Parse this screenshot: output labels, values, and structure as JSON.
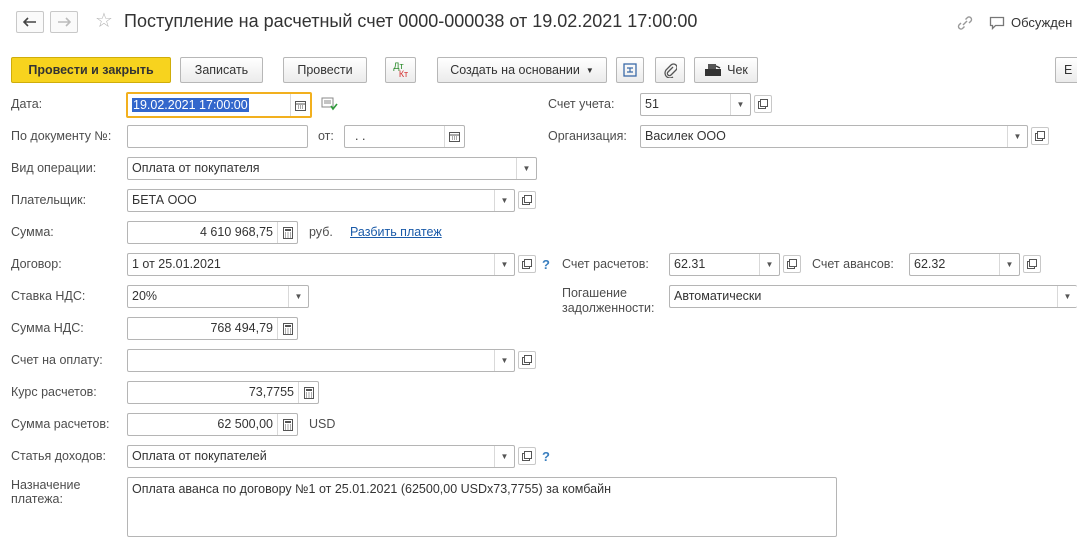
{
  "header": {
    "title": "Поступление на расчетный счет 0000-000038 от 19.02.2021 17:00:00",
    "discussion_label": "Обсужден"
  },
  "toolbar": {
    "post_close": "Провести и закрыть",
    "save": "Записать",
    "post": "Провести",
    "dt_kt_top": "Дт",
    "dt_kt_bottom": "Кт",
    "create_based": "Создать на основании",
    "receipt": "Чек",
    "more_label": "Е"
  },
  "form": {
    "date": {
      "label": "Дата:",
      "value": "19.02.2021 17:00:00"
    },
    "doc_number": {
      "label": "По документу №:",
      "value": ""
    },
    "doc_from": {
      "label": "от:",
      "value": " .  ."
    },
    "operation_type": {
      "label": "Вид операции:",
      "value": "Оплата от покупателя"
    },
    "payer": {
      "label": "Плательщик:",
      "value": "БЕТА ООО"
    },
    "amount": {
      "label": "Сумма:",
      "value": "4 610 968,75",
      "currency": "руб.",
      "split_link": "Разбить платеж"
    },
    "contract": {
      "label": "Договор:",
      "value": "1 от 25.01.2021",
      "help": "?"
    },
    "vat_rate": {
      "label": "Ставка НДС:",
      "value": "20%"
    },
    "vat_amount": {
      "label": "Сумма НДС:",
      "value": "768 494,79"
    },
    "invoice": {
      "label": "Счет на оплату:",
      "value": ""
    },
    "rate": {
      "label": "Курс расчетов:",
      "value": "73,7755"
    },
    "settlement_amount": {
      "label": "Сумма расчетов:",
      "value": "62 500,00",
      "currency": "USD"
    },
    "income_item": {
      "label": "Статья доходов:",
      "value": "Оплата от покупателей",
      "help": "?"
    },
    "purpose": {
      "label_line1": "Назначение",
      "label_line2": "платежа:",
      "value": "Оплата аванса по договору №1 от 25.01.2021 (62500,00 USDx73,7755) за комбайн"
    },
    "account": {
      "label": "Счет учета:",
      "value": "51"
    },
    "organization": {
      "label": "Организация:",
      "value": "Василек ООО"
    },
    "settlement_account": {
      "label": "Счет расчетов:",
      "value": "62.31"
    },
    "advance_account": {
      "label": "Счет авансов:",
      "value": "62.32"
    },
    "debt_repayment": {
      "label_line1": "Погашение",
      "label_line2": "задолженности:",
      "value": "Автоматически"
    }
  },
  "colors": {
    "primary_button": "#f7d31e",
    "focus_border": "#f2b01e",
    "selection": "#3367cc",
    "link": "#1a5aa8"
  }
}
